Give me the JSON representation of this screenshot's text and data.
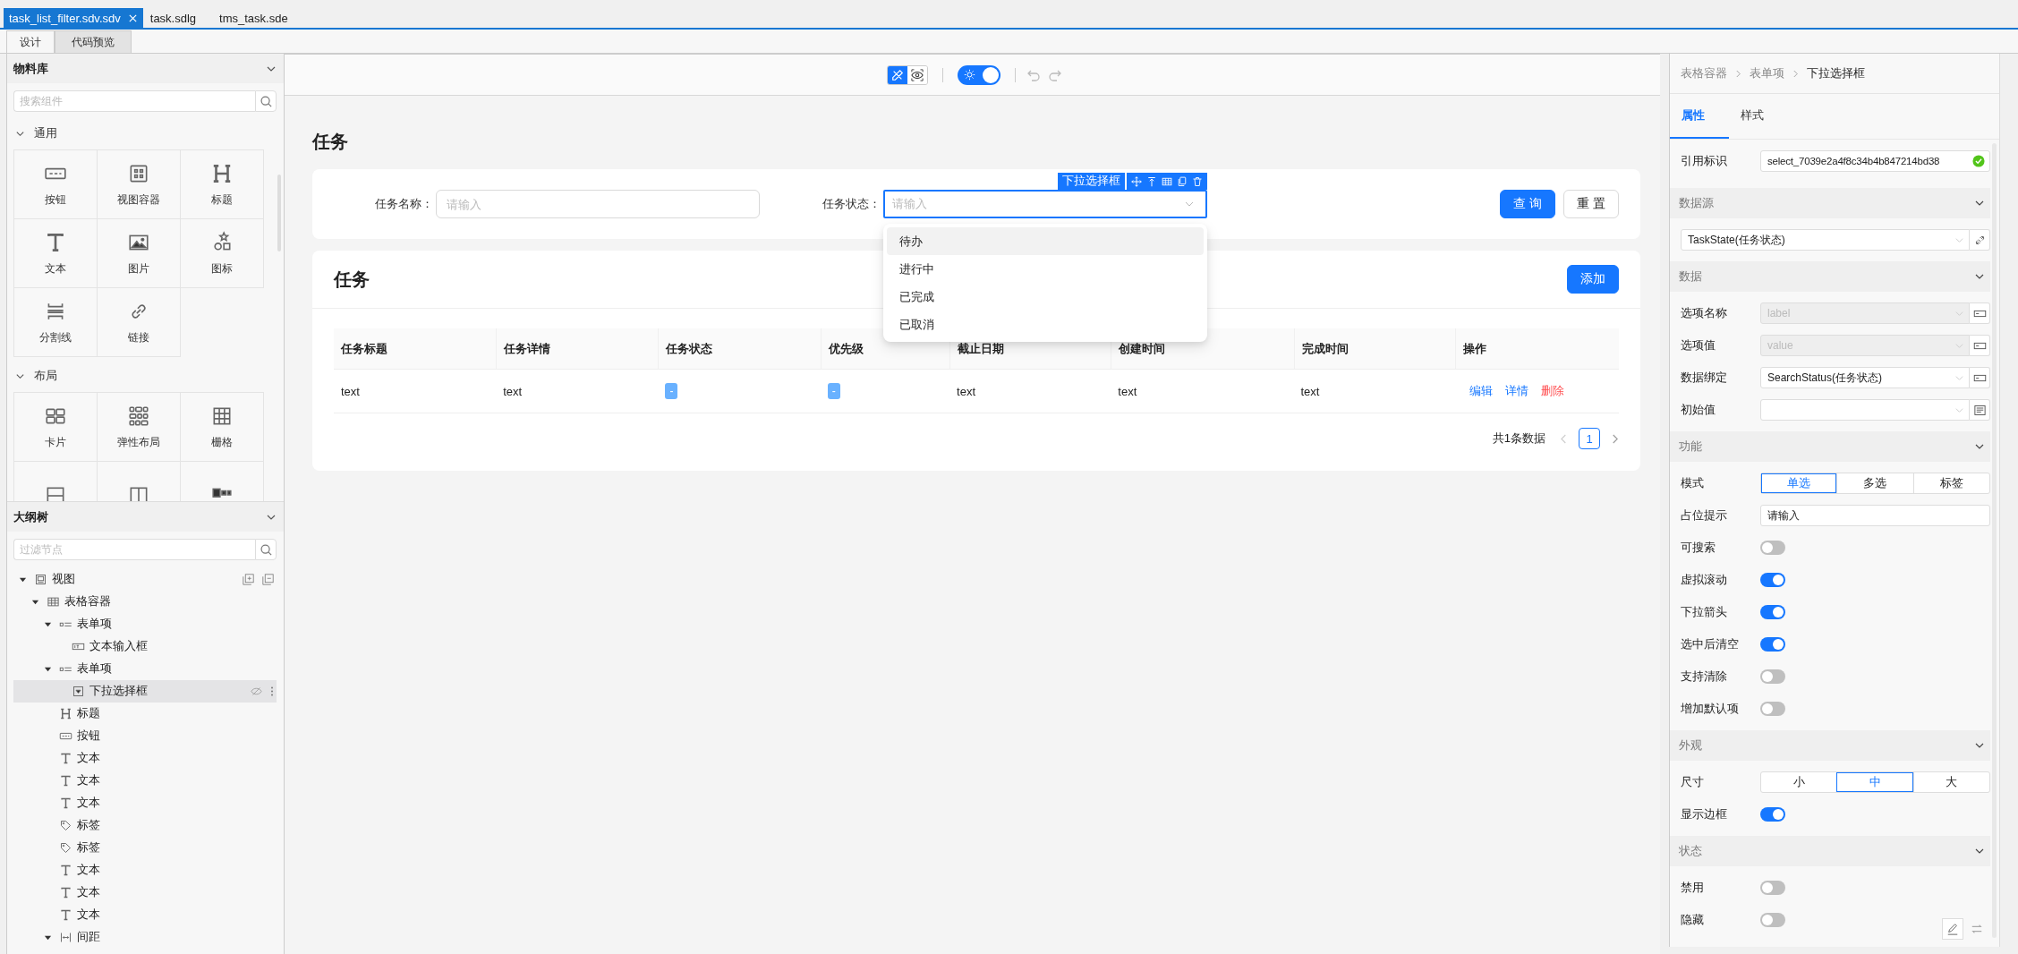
{
  "file_tabs": [
    {
      "label": "task_list_filter.sdv.sdv",
      "selected": true
    },
    {
      "label": "task.sdlg",
      "selected": false
    },
    {
      "label": "tms_task.sde",
      "selected": false
    }
  ],
  "editor_tabs": [
    {
      "label": "设计",
      "selected": true
    },
    {
      "label": "代码预览",
      "selected": false
    }
  ],
  "library": {
    "title": "物料库",
    "search": {
      "placeholder": "搜索组件"
    },
    "groups": [
      {
        "title": "通用",
        "expanded": true,
        "items": [
          {
            "kind": "button",
            "label": "按钮"
          },
          {
            "kind": "view-container",
            "label": "视图容器"
          },
          {
            "kind": "heading",
            "label": "标题"
          },
          {
            "kind": "text",
            "label": "文本"
          },
          {
            "kind": "image",
            "label": "图片"
          },
          {
            "kind": "icon",
            "label": "图标"
          },
          {
            "kind": "divider",
            "label": "分割线"
          },
          {
            "kind": "link",
            "label": "链接"
          }
        ]
      },
      {
        "title": "布局",
        "expanded": true,
        "items": [
          {
            "kind": "card",
            "label": "卡片"
          },
          {
            "kind": "flex",
            "label": "弹性布局"
          },
          {
            "kind": "grid",
            "label": "栅格"
          },
          {
            "kind": "rows"
          },
          {
            "kind": "columns"
          },
          {
            "kind": "form-row"
          }
        ]
      }
    ]
  },
  "outline": {
    "title": "大纲树",
    "search": {
      "placeholder": "过滤节点"
    },
    "nodes": [
      {
        "kind": "view",
        "label": "视图",
        "expanded": true,
        "selected": false,
        "children": [
          {
            "kind": "table-container",
            "label": "表格容器",
            "expanded": true,
            "selected": false,
            "children": [
              {
                "kind": "form-item",
                "label": "表单项",
                "expanded": true,
                "selected": false,
                "children": [
                  {
                    "kind": "input",
                    "label": "文本输入框",
                    "selected": false
                  }
                ]
              },
              {
                "kind": "form-item",
                "label": "表单项",
                "expanded": true,
                "selected": false,
                "children": [
                  {
                    "kind": "select",
                    "label": "下拉选择框",
                    "selected": true
                  }
                ]
              },
              {
                "kind": "heading",
                "label": "标题",
                "selected": false
              },
              {
                "kind": "button",
                "label": "按钮",
                "selected": false
              },
              {
                "kind": "text",
                "label": "文本",
                "selected": false
              },
              {
                "kind": "text",
                "label": "文本",
                "selected": false
              },
              {
                "kind": "text",
                "label": "文本",
                "selected": false
              },
              {
                "kind": "tag",
                "label": "标签",
                "selected": false
              },
              {
                "kind": "tag",
                "label": "标签",
                "selected": false
              },
              {
                "kind": "text",
                "label": "文本",
                "selected": false
              },
              {
                "kind": "text",
                "label": "文本",
                "selected": false
              },
              {
                "kind": "text",
                "label": "文本",
                "selected": false
              },
              {
                "kind": "spacing",
                "label": "间距",
                "expanded": true,
                "selected": false
              }
            ]
          }
        ]
      }
    ]
  },
  "toolbar": {
    "modes": [
      {
        "kind": "design",
        "selected": true
      },
      {
        "kind": "preview",
        "selected": false
      }
    ],
    "theme_toggle": {
      "on": true
    }
  },
  "page": {
    "title": "任务",
    "filter": {
      "fields": [
        {
          "kind": "input",
          "label": "任务名称：",
          "placeholder": "请输入",
          "selected": false
        },
        {
          "kind": "select",
          "label": "任务状态：",
          "placeholder": "请输入",
          "selected": true
        }
      ],
      "selection_label": "下拉选择框",
      "options": [
        {
          "label": "待办",
          "selected": true
        },
        {
          "label": "进行中",
          "selected": false
        },
        {
          "label": "已完成",
          "selected": false
        },
        {
          "label": "已取消",
          "selected": false
        }
      ],
      "buttons": [
        {
          "kind": "primary",
          "label": "查 询"
        },
        {
          "kind": "default",
          "label": "重 置"
        }
      ]
    },
    "table_card": {
      "title": "任务",
      "add_button": "添加",
      "columns": [
        "任务标题",
        "任务详情",
        "任务状态",
        "优先级",
        "截止日期",
        "创建时间",
        "完成时间",
        "操作"
      ],
      "rows": [
        [
          {
            "kind": "text",
            "text": "text"
          },
          {
            "kind": "text",
            "text": "text"
          },
          {
            "kind": "tag",
            "text": "-"
          },
          {
            "kind": "tag",
            "text": "-"
          },
          {
            "kind": "text",
            "text": "text"
          },
          {
            "kind": "text",
            "text": "text"
          },
          {
            "kind": "text",
            "text": "text"
          },
          {
            "kind": "actions",
            "actions": [
              {
                "kind": "link",
                "label": "编辑"
              },
              {
                "kind": "link",
                "label": "详情"
              },
              {
                "kind": "danger",
                "label": "删除"
              }
            ]
          }
        ]
      ],
      "total": "共1条数据",
      "pages": [
        {
          "label": "1",
          "selected": true
        }
      ]
    }
  },
  "inspector": {
    "breadcrumb": [
      "表格容器",
      "表单项",
      "下拉选择框"
    ],
    "tabs": [
      {
        "label": "属性",
        "selected": true
      },
      {
        "label": "样式",
        "selected": false
      }
    ],
    "ref": {
      "label": "引用标识",
      "value": "select_7039e2a4f8c34b4b847214bd38",
      "valid": true
    },
    "sections": [
      {
        "title": "数据源",
        "expanded": true,
        "rows": [
          {
            "kind": "select",
            "value": "TaskState(任务状态)",
            "disabled": false,
            "addon": {
              "kind": "link"
            }
          }
        ]
      },
      {
        "title": "数据",
        "expanded": true,
        "rows": [
          {
            "kind": "select",
            "label": "选项名称",
            "value": "label",
            "disabled": true,
            "addon": {
              "kind": "bind"
            }
          },
          {
            "kind": "select",
            "label": "选项值",
            "value": "value",
            "disabled": true,
            "addon": {
              "kind": "bind"
            }
          },
          {
            "kind": "select",
            "label": "数据绑定",
            "value": "SearchStatus(任务状态)",
            "disabled": false,
            "addon": {
              "kind": "bind"
            }
          },
          {
            "kind": "select",
            "label": "初始值",
            "disabled": false,
            "addon": {
              "kind": "list"
            }
          }
        ]
      },
      {
        "title": "功能",
        "expanded": true,
        "rows": [
          {
            "kind": "segmented",
            "label": "模式",
            "options": [
              {
                "label": "单选",
                "selected": true
              },
              {
                "label": "多选",
                "selected": false
              },
              {
                "label": "标签",
                "selected": false
              }
            ]
          },
          {
            "kind": "input",
            "label": "占位提示",
            "value": "请输入"
          },
          {
            "kind": "switch",
            "label": "可搜索",
            "on": false
          },
          {
            "kind": "switch",
            "label": "虚拟滚动",
            "on": true
          },
          {
            "kind": "switch",
            "label": "下拉箭头",
            "on": true
          },
          {
            "kind": "switch",
            "label": "选中后清空",
            "on": true
          },
          {
            "kind": "switch",
            "label": "支持清除",
            "on": false
          },
          {
            "kind": "switch",
            "label": "增加默认项",
            "on": false
          }
        ]
      },
      {
        "title": "外观",
        "expanded": true,
        "rows": [
          {
            "kind": "segmented",
            "label": "尺寸",
            "options": [
              {
                "label": "小",
                "selected": false
              },
              {
                "label": "中",
                "selected": true
              },
              {
                "label": "大",
                "selected": false
              }
            ]
          },
          {
            "kind": "switch",
            "label": "显示边框",
            "on": true
          }
        ]
      },
      {
        "title": "状态",
        "expanded": true,
        "rows": [
          {
            "kind": "switch",
            "label": "禁用",
            "on": false
          },
          {
            "kind": "switch",
            "label": "隐藏",
            "on": false
          }
        ]
      }
    ]
  }
}
